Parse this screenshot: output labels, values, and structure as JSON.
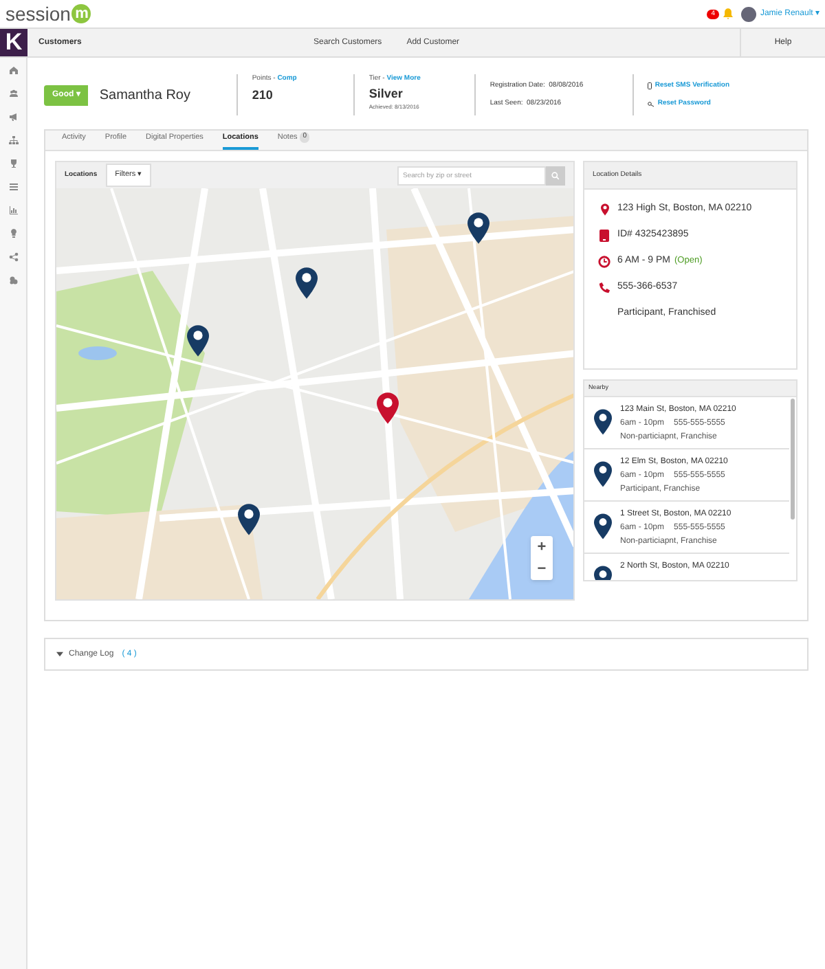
{
  "topbar": {
    "logo": "session",
    "logo_mark": "m",
    "notification_count": "4",
    "user": "Jamie Renault ▾"
  },
  "navbar": {
    "logo": "K",
    "title": "Customers",
    "links": [
      "Search Customers",
      "Add Customer"
    ],
    "help": "Help"
  },
  "customer": {
    "status": "Good ▾",
    "name": "Samantha Roy",
    "points_label": "Points - ",
    "points_link": "Comp",
    "points": "210",
    "tier_label": "Tier - ",
    "tier_link": "View More",
    "tier": "Silver",
    "achieved": "Achieved: 8/13/2016",
    "registration": "Registration Date:  08/08/2016",
    "last_seen": "Last Seen:  08/23/2016",
    "actions": [
      {
        "kind": "phone",
        "label": "Reset SMS Verification"
      },
      {
        "kind": "key",
        "label": "Reset Password"
      }
    ]
  },
  "tabs": [
    {
      "label": "Activity",
      "selected": false
    },
    {
      "label": "Profile",
      "selected": false
    },
    {
      "label": "Digital Properties",
      "selected": false
    },
    {
      "label": "Locations",
      "selected": true
    },
    {
      "label": "Notes",
      "selected": false,
      "count": "0"
    }
  ],
  "map_toolbar": {
    "title": "Locations",
    "filters": "Filters ▾",
    "search": {
      "placeholder": "Search by zip or street"
    }
  },
  "map": {
    "pins": [
      {
        "kind": "other"
      },
      {
        "kind": "other"
      },
      {
        "kind": "other"
      },
      {
        "kind": "selected"
      },
      {
        "kind": "other"
      }
    ],
    "zoom": [
      "+",
      "−"
    ]
  },
  "location_details": {
    "title": "Location Details",
    "items": [
      {
        "kind": "pin",
        "text": "123 High St, Boston, MA 02210"
      },
      {
        "kind": "id",
        "text": "ID# 4325423895"
      },
      {
        "kind": "clock",
        "text": "6 AM - 9 PM",
        "status": "(Open)"
      },
      {
        "kind": "phone",
        "text": "555-366-6537"
      },
      {
        "kind": "none",
        "text": "Participant, Franchised"
      }
    ]
  },
  "nearby": {
    "title": "Nearby",
    "items": [
      {
        "address": "123 Main St, Boston, MA 02210",
        "hours": "6am - 10pm",
        "phone": "555-555-5555",
        "type": "Non-particiapnt, Franchise"
      },
      {
        "address": "12 Elm St, Boston, MA 02210",
        "hours": "6am - 10pm",
        "phone": "555-555-5555",
        "type": "Participant, Franchise"
      },
      {
        "address": "1 Street St, Boston, MA 02210",
        "hours": "6am - 10pm",
        "phone": "555-555-5555",
        "type": "Non-particiapnt, Franchise"
      },
      {
        "address": "2 North St, Boston, MA 02210"
      }
    ]
  },
  "change_log": {
    "label": "Change Log",
    "count": "( 4 )"
  }
}
